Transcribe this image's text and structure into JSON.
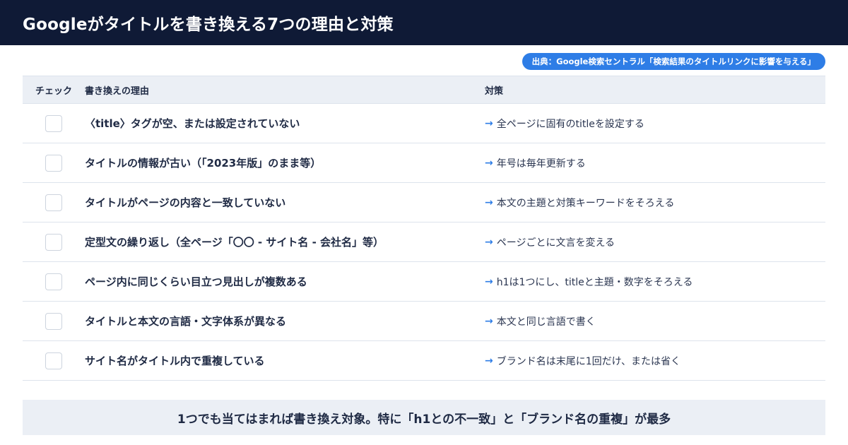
{
  "header": {
    "title": "Googleがタイトルを書き換える7つの理由と対策"
  },
  "source_badge": "出典：Google検索セントラル「検索結果のタイトルリンクに影響を与える」",
  "table": {
    "columns": {
      "check": "チェック",
      "reason": "書き換えの理由",
      "solution": "対策"
    },
    "arrow": "→",
    "rows": [
      {
        "reason": "〈title〉タグが空、または設定されていない",
        "solution": "全ページに固有のtitleを設定する"
      },
      {
        "reason": "タイトルの情報が古い（「2023年版」のまま等）",
        "solution": "年号は毎年更新する"
      },
      {
        "reason": "タイトルがページの内容と一致していない",
        "solution": "本文の主題と対策キーワードをそろえる"
      },
      {
        "reason": "定型文の繰り返し（全ページ「〇〇 - サイト名 - 会社名」等）",
        "solution": "ページごとに文言を変える"
      },
      {
        "reason": "ページ内に同じくらい目立つ見出しが複数ある",
        "solution": "h1は1つにし、titleと主題・数字をそろえる"
      },
      {
        "reason": "タイトルと本文の言語・文字体系が異なる",
        "solution": "本文と同じ言語で書く"
      },
      {
        "reason": "サイト名がタイトル内で重複している",
        "solution": "ブランド名は末尾に1回だけ、または省く"
      }
    ]
  },
  "footer": {
    "text": "1つでも当てはまれば書き換え対象。特に「h1との不一致」と「ブランド名の重複」が最多"
  },
  "colors": {
    "header_bg": "#0f1a36",
    "accent": "#2e7de6",
    "table_header_bg": "#ebeff5"
  }
}
